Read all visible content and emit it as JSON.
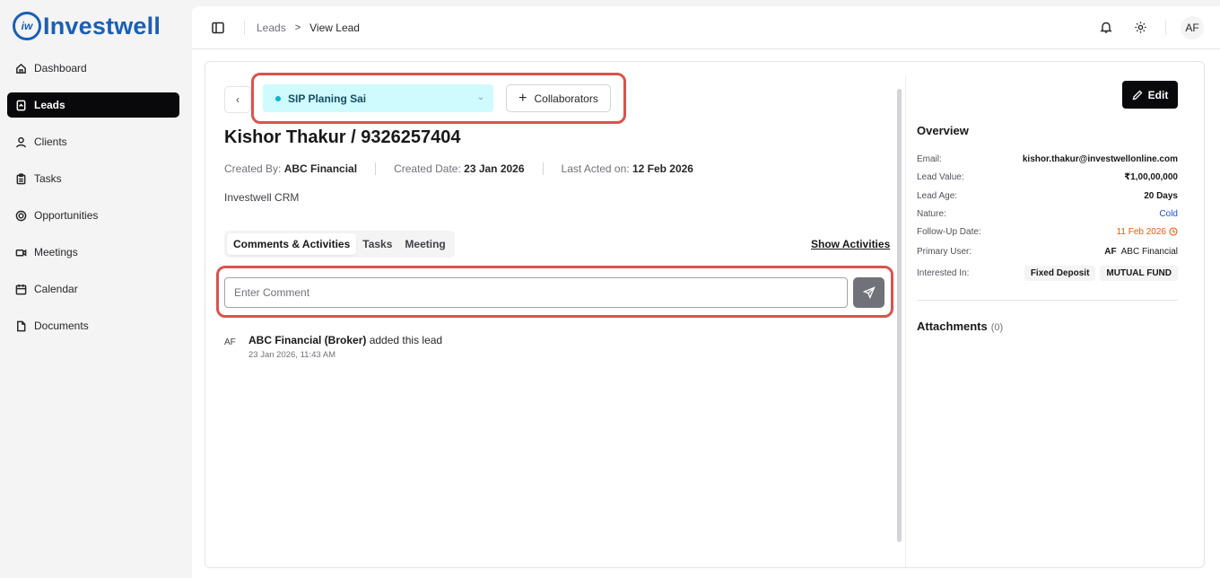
{
  "brand": {
    "name": "Investwell",
    "mark": "iw"
  },
  "sidebar": {
    "items": [
      {
        "label": "Dashboard",
        "icon": "home-icon"
      },
      {
        "label": "Leads",
        "icon": "file-icon",
        "active": true
      },
      {
        "label": "Clients",
        "icon": "user-icon"
      },
      {
        "label": "Tasks",
        "icon": "clipboard-icon"
      },
      {
        "label": "Opportunities",
        "icon": "target-icon"
      },
      {
        "label": "Meetings",
        "icon": "video-icon"
      },
      {
        "label": "Calendar",
        "icon": "calendar-icon"
      },
      {
        "label": "Documents",
        "icon": "document-icon"
      }
    ]
  },
  "topbar": {
    "breadcrumb_parent": "Leads",
    "breadcrumb_sep": ">",
    "breadcrumb_current": "View Lead",
    "avatar_initials": "AF"
  },
  "lead": {
    "stage": "SIP Planing Sai",
    "collaborators_label": "Collaborators",
    "title": "Kishor Thakur / 9326257404",
    "created_by_label": "Created By:",
    "created_by": "ABC Financial",
    "created_date_label": "Created Date:",
    "created_date": "23 Jan 2026",
    "last_acted_label": "Last Acted on:",
    "last_acted": "12 Feb 2026",
    "source": "Investwell CRM"
  },
  "tabs": [
    "Comments & Activities",
    "Tasks",
    "Meeting"
  ],
  "show_activities_label": "Show Activities",
  "comment": {
    "placeholder": "Enter Comment",
    "value": ""
  },
  "activity": {
    "avatar": "AF",
    "actor": "ABC Financial (Broker)",
    "action": "added this lead",
    "time": "23 Jan 2026, 11:43 AM"
  },
  "overview": {
    "edit_label": "Edit",
    "title": "Overview",
    "rows": {
      "email": {
        "label": "Email:",
        "value": "kishor.thakur@investwellonline.com"
      },
      "lead_value": {
        "label": "Lead Value:",
        "value": "₹1,00,00,000"
      },
      "lead_age": {
        "label": "Lead Age:",
        "value": "20 Days"
      },
      "nature": {
        "label": "Nature:",
        "value": "Cold"
      },
      "follow_up": {
        "label": "Follow-Up Date:",
        "value": "11 Feb 2026"
      },
      "primary_user": {
        "label": "Primary User:",
        "initials": "AF",
        "value": "ABC Financial"
      },
      "interested_in": {
        "label": "Interested In:",
        "chips": [
          "Fixed Deposit",
          "MUTUAL FUND"
        ]
      }
    },
    "attachments_label": "Attachments",
    "attachments_count": "(0)"
  },
  "colors": {
    "brand": "#1a5fb4",
    "stage_bg": "#cffafe",
    "stage_dot": "#06b6d4",
    "highlight": "#d9534f",
    "nature_blue": "#1d4ed8",
    "followup_orange": "#ea580c"
  }
}
